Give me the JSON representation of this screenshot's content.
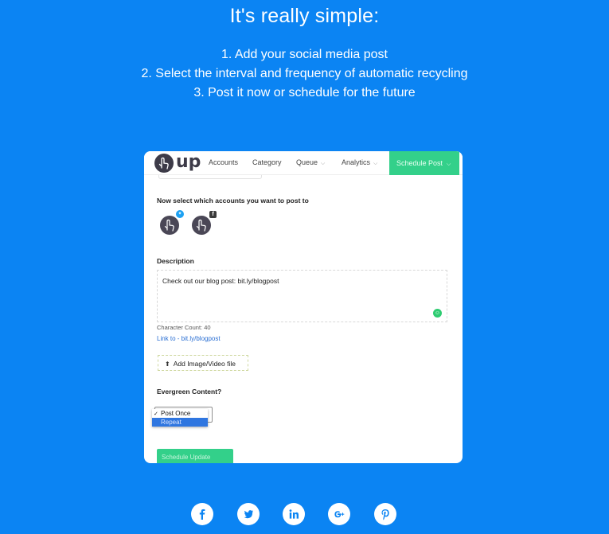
{
  "hero": {
    "headline": "It's really simple:",
    "steps": [
      "1. Add your social media post",
      "2. Select the interval and frequency of automatic recycling",
      "3. Post it now or schedule for the future"
    ]
  },
  "app": {
    "logo_text": "up",
    "nav": {
      "accounts": "Accounts",
      "category": "Category",
      "queue": "Queue",
      "analytics": "Analytics",
      "schedule_post": "Schedule Post"
    },
    "accounts_heading": "Now select which accounts you want to post to",
    "accounts": [
      {
        "network": "twitter",
        "badge_icon": "twitter-icon"
      },
      {
        "network": "facebook",
        "badge_icon": "facebook-icon"
      }
    ],
    "description_label": "Description",
    "description_value": "Check out our blog post: bit.ly/blogpost",
    "character_count": "Character Count: 40",
    "link_to": "Link to - bit.ly/blogpost",
    "upload_label": "Add Image/Video file",
    "evergreen_label": "Evergreen Content?",
    "evergreen_options": [
      "Post Once",
      "Repeat"
    ],
    "evergreen_selected": "Post Once",
    "submit_label": "Schedule Update"
  },
  "social_links": [
    "facebook-icon",
    "twitter-icon",
    "linkedin-icon",
    "google-plus-icon",
    "pinterest-icon"
  ],
  "colors": {
    "background": "#0b84f3",
    "accent_green": "#33d08a",
    "link_blue": "#2a6fd3",
    "logo_dark": "#3d3b48"
  }
}
